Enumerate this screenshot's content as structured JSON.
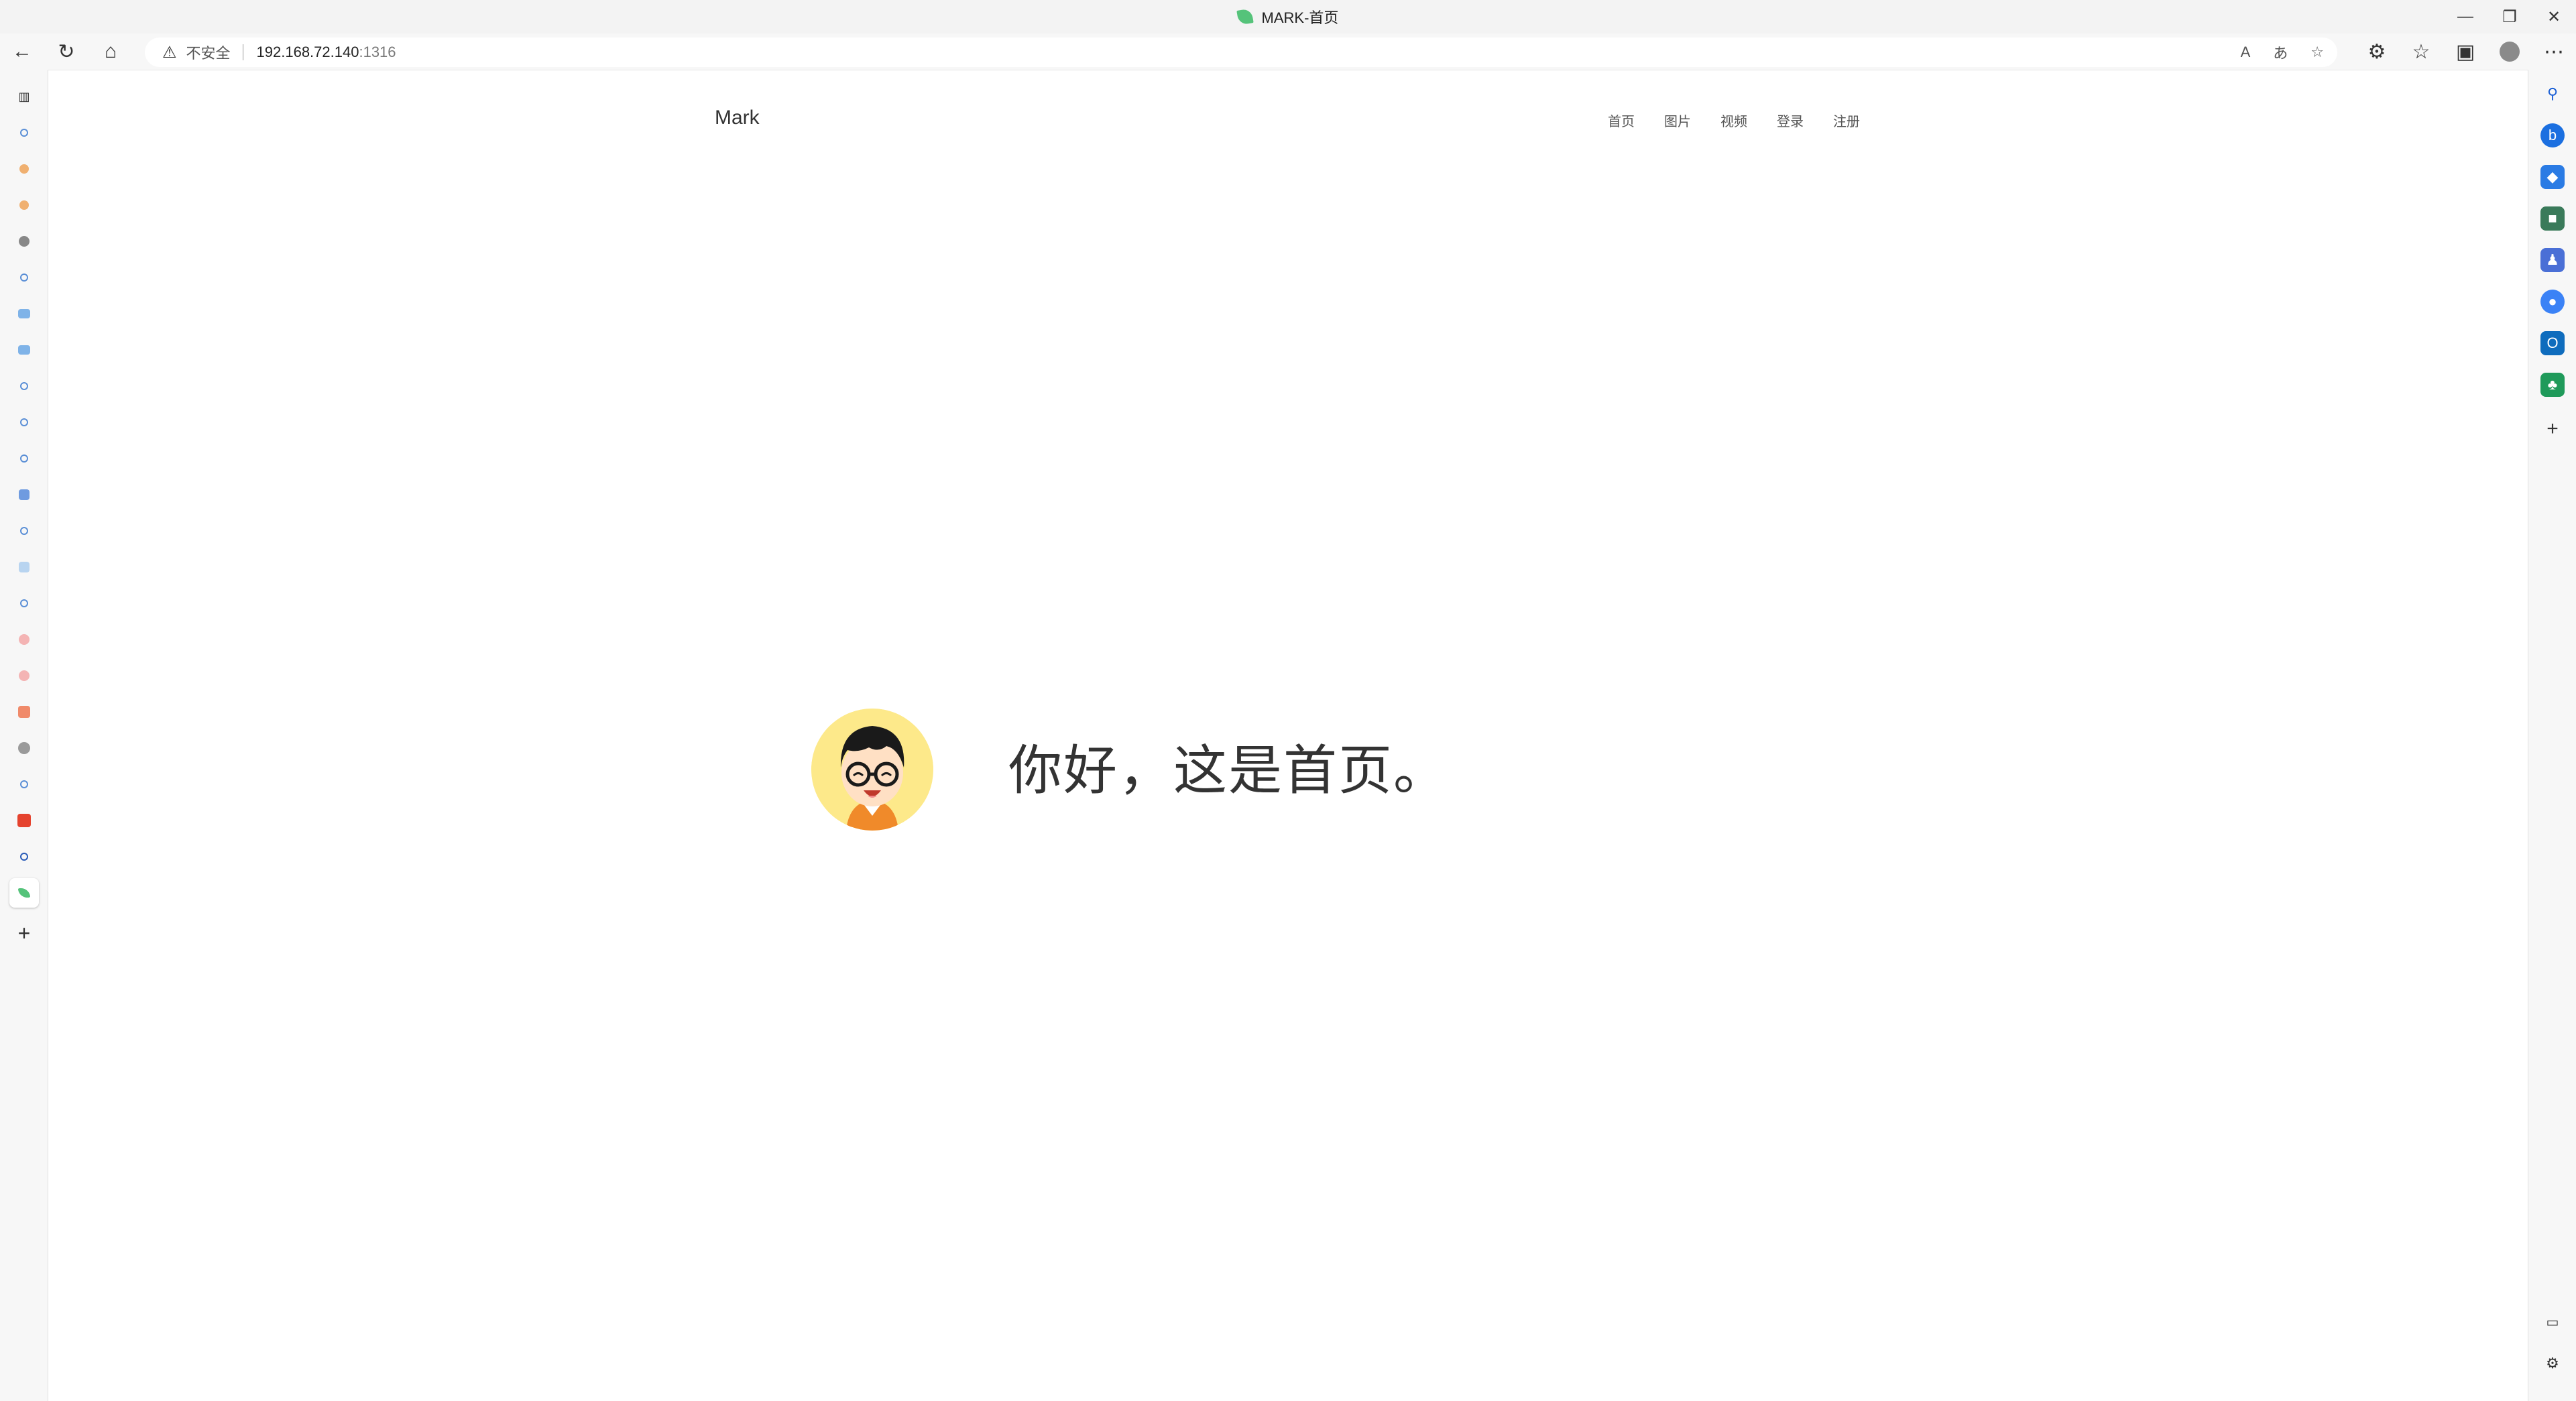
{
  "window": {
    "tab_title": "MARK-首页"
  },
  "addressbar": {
    "security_label": "不安全",
    "host": "192.168.72.140",
    "port": ":1316"
  },
  "page": {
    "brand": "Mark",
    "nav": [
      "首页",
      "图片",
      "视频",
      "登录",
      "注册"
    ],
    "headline": "你好，这是首页。"
  },
  "colors": {
    "accent_leaf": "#55c37a",
    "avatar_bg": "#fde98a"
  },
  "icons": {
    "back": "back-arrow-icon",
    "refresh": "refresh-icon",
    "home": "home-icon",
    "warning": "warning-icon",
    "read_aloud": "read-aloud-icon",
    "translate": "translate-icon",
    "favorite_add": "add-favorite-icon",
    "extensions": "extensions-icon",
    "favorites": "favorites-icon",
    "collections": "collections-icon",
    "profile": "profile-icon",
    "more": "more-icon"
  }
}
